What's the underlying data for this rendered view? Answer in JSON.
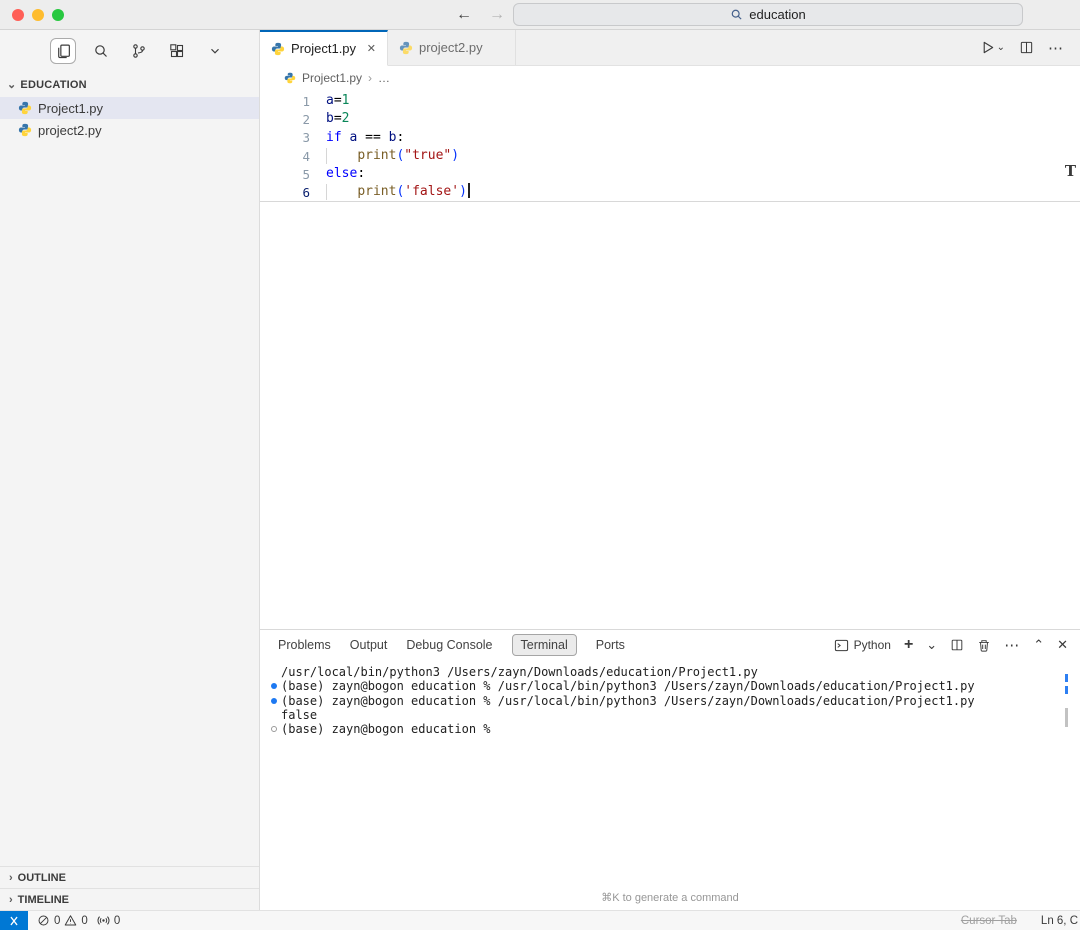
{
  "icons": {
    "close": "✕",
    "chevron_down": "⌄",
    "chevron_up": "⌃",
    "more": "⋯",
    "plus": "+",
    "back_arrow": "←",
    "forward_arrow": "→",
    "breadcrumb_sep": "›",
    "breadcrumb_more": "…",
    "sidebar_chevron_down": "⌄",
    "sidebar_chevron_right": "›"
  },
  "titlebar": {
    "search_value": "education"
  },
  "sidebar": {
    "explorer_title": "EDUCATION",
    "files": [
      {
        "name": "Project1.py"
      },
      {
        "name": "project2.py"
      }
    ],
    "outline": "OUTLINE",
    "timeline": "TIMELINE"
  },
  "editor": {
    "tabs": [
      {
        "label": "Project1.py"
      },
      {
        "label": "project2.py"
      }
    ],
    "breadcrumb_file": "Project1.py",
    "overview_mark": "T",
    "lines": [
      {
        "num": "1",
        "tokens": [
          {
            "t": "a",
            "c": "var"
          },
          {
            "t": "=",
            "c": "pln"
          },
          {
            "t": "1",
            "c": "num"
          }
        ]
      },
      {
        "num": "2",
        "tokens": [
          {
            "t": "b",
            "c": "var"
          },
          {
            "t": "=",
            "c": "pln"
          },
          {
            "t": "2",
            "c": "num"
          }
        ]
      },
      {
        "num": "3",
        "tokens": [
          {
            "t": "if",
            "c": "kw"
          },
          {
            "t": " ",
            "c": "pln"
          },
          {
            "t": "a",
            "c": "var"
          },
          {
            "t": " == ",
            "c": "pln"
          },
          {
            "t": "b",
            "c": "var"
          },
          {
            "t": ":",
            "c": "pln"
          }
        ]
      },
      {
        "num": "4",
        "indent_guide": true,
        "tokens": [
          {
            "t": "    ",
            "c": "pln"
          },
          {
            "t": "print",
            "c": "fn"
          },
          {
            "t": "(",
            "c": "br"
          },
          {
            "t": "\"true\"",
            "c": "str"
          },
          {
            "t": ")",
            "c": "br"
          }
        ]
      },
      {
        "num": "5",
        "tokens": [
          {
            "t": "else",
            "c": "kw"
          },
          {
            "t": ":",
            "c": "pln"
          }
        ]
      },
      {
        "num": "6",
        "active": true,
        "cursor": true,
        "indent_guide": true,
        "tokens": [
          {
            "t": "    ",
            "c": "pln"
          },
          {
            "t": "print",
            "c": "fn"
          },
          {
            "t": "(",
            "c": "br"
          },
          {
            "t": "'false'",
            "c": "str"
          },
          {
            "t": ")",
            "c": "br"
          }
        ]
      }
    ]
  },
  "panel": {
    "tabs": [
      "Problems",
      "Output",
      "Debug Console",
      "Terminal",
      "Ports"
    ],
    "active_tab": "Terminal",
    "shell_label": "Python",
    "hint": "⌘K to generate a command"
  },
  "terminal": {
    "lines": [
      {
        "dot": "none",
        "text": "/usr/local/bin/python3 /Users/zayn/Downloads/education/Project1.py"
      },
      {
        "dot": "filled",
        "text": "(base) zayn@bogon education % /usr/local/bin/python3 /Users/zayn/Downloads/education/Project1.py"
      },
      {
        "dot": "filled",
        "text": "(base) zayn@bogon education % /usr/local/bin/python3 /Users/zayn/Downloads/education/Project1.py"
      },
      {
        "dot": "none",
        "text": "false"
      },
      {
        "dot": "hollow",
        "text": "(base) zayn@bogon education %"
      }
    ]
  },
  "statusbar": {
    "errors": "0",
    "warnings": "0",
    "ports": "0",
    "cursor_tab": "Cursor Tab",
    "position": "Ln 6, C"
  },
  "colors": {
    "accent_blue": "#0066b8",
    "python_blue": "#3776ab",
    "python_yellow": "#ffd43b",
    "remote_bg": "#0078d4",
    "terminal_dot": "#1d79f2",
    "selected_row": "#e4e6f1",
    "traffic_red": "#ff5f57",
    "traffic_yellow": "#febc2e",
    "traffic_green": "#28c840"
  }
}
